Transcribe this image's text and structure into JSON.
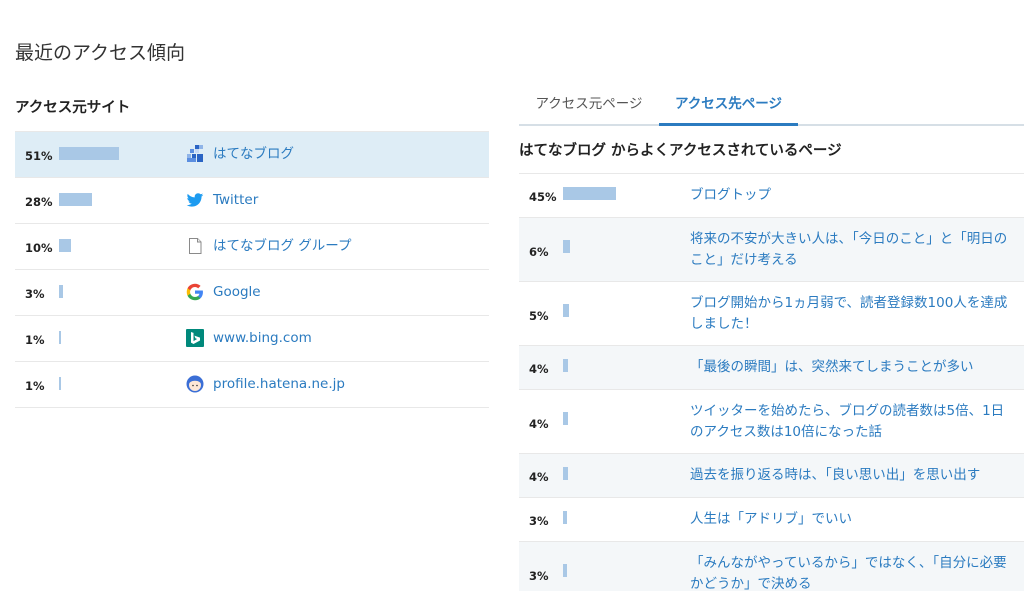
{
  "page": {
    "title": "最近のアクセス傾向"
  },
  "referrers": {
    "title": "アクセス元サイト",
    "items": [
      {
        "percent": "51%",
        "value": 51,
        "label": "はてなブログ",
        "icon": "hatena-blog-icon",
        "highlighted": true
      },
      {
        "percent": "28%",
        "value": 28,
        "label": "Twitter",
        "icon": "twitter-icon"
      },
      {
        "percent": "10%",
        "value": 10,
        "label": "はてなブログ グループ",
        "icon": "document-icon"
      },
      {
        "percent": "3%",
        "value": 3,
        "label": "Google",
        "icon": "google-icon"
      },
      {
        "percent": "1%",
        "value": 1,
        "label": "www.bing.com",
        "icon": "bing-icon"
      },
      {
        "percent": "1%",
        "value": 1,
        "label": "profile.hatena.ne.jp",
        "icon": "profile-avatar-icon"
      }
    ]
  },
  "tabs": {
    "source": "アクセス元ページ",
    "destination": "アクセス先ページ",
    "active": "destination"
  },
  "destination": {
    "title": "はてなブログ からよくアクセスされているページ",
    "items": [
      {
        "percent": "45%",
        "value": 45,
        "label": "ブログトップ"
      },
      {
        "percent": "6%",
        "value": 6,
        "label": "将来の不安が大きい人は、「今日のこと」と「明日のこと」だけ考える"
      },
      {
        "percent": "5%",
        "value": 5,
        "label": "ブログ開始から1ヵ月弱で、読者登録数100人を達成しました！"
      },
      {
        "percent": "4%",
        "value": 4,
        "label": "「最後の瞬間」は、突然来てしまうことが多い"
      },
      {
        "percent": "4%",
        "value": 4,
        "label": "ツイッターを始めたら、ブログの読者数は5倍、1日のアクセス数は10倍になった話"
      },
      {
        "percent": "4%",
        "value": 4,
        "label": "過去を振り返る時は、「良い思い出」を思い出す"
      },
      {
        "percent": "3%",
        "value": 3,
        "label": "人生は「アドリブ」でいい"
      },
      {
        "percent": "3%",
        "value": 3,
        "label": "「みんながやっているから」ではなく、「自分に必要かどうか」で決める"
      }
    ]
  },
  "colors": {
    "accent": "#2b7bc0",
    "bar": "#a9c8e6",
    "highlight": "#deedf6"
  }
}
